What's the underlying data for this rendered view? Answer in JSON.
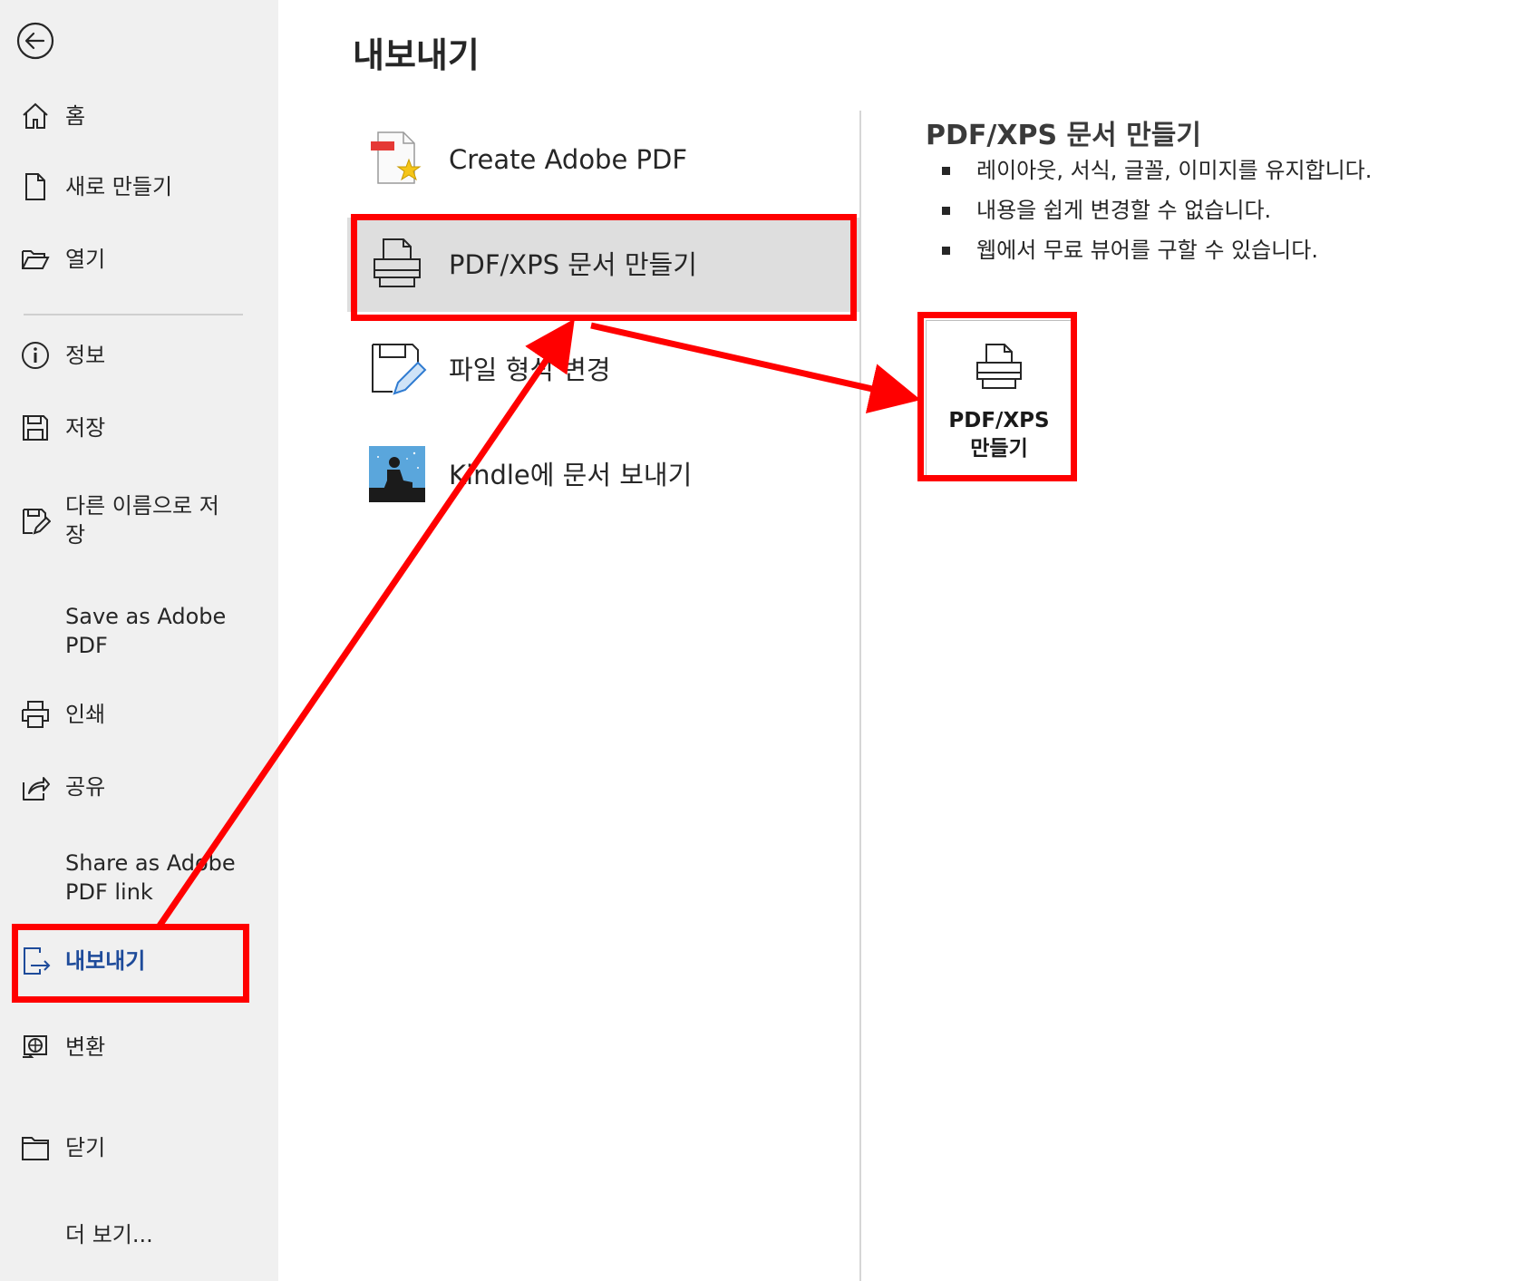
{
  "sidebar": {
    "items": [
      {
        "label": "홈",
        "icon": "home-icon"
      },
      {
        "label": "새로 만들기",
        "icon": "new-document-icon"
      },
      {
        "label": "열기",
        "icon": "open-folder-icon"
      },
      {
        "label": "정보",
        "icon": "info-icon"
      },
      {
        "label": "저장",
        "icon": "save-icon"
      },
      {
        "label": "다른 이름으로 저\n장",
        "icon": "save-as-icon"
      },
      {
        "label": "Save as Adobe\nPDF",
        "icon": ""
      },
      {
        "label": "인쇄",
        "icon": "printer-icon"
      },
      {
        "label": "공유",
        "icon": "share-icon"
      },
      {
        "label": "Share as Adobe\nPDF link",
        "icon": ""
      },
      {
        "label": "내보내기",
        "icon": "export-icon"
      },
      {
        "label": "변환",
        "icon": "transform-icon"
      },
      {
        "label": "닫기",
        "icon": "close-folder-icon"
      },
      {
        "label": "더 보기...",
        "icon": ""
      }
    ],
    "back_icon": "back-arrow-icon",
    "active_label": "내보내기"
  },
  "main": {
    "title": "내보내기",
    "export_options": [
      {
        "label": "Create Adobe PDF",
        "icon": "adobe-pdf-icon"
      },
      {
        "label": "PDF/XPS 문서 만들기",
        "icon": "pdf-xps-printer-icon"
      },
      {
        "label": "파일 형식 변경",
        "icon": "change-file-type-icon"
      },
      {
        "label": "Kindle에 문서 보내기",
        "icon": "kindle-icon"
      }
    ],
    "selected_option": "PDF/XPS 문서 만들기"
  },
  "detail": {
    "title": "PDF/XPS 문서 만들기",
    "bullets": [
      "레이아웃, 서식, 글꼴, 이미지를 유지합니다.",
      "내용을 쉽게 변경할 수 없습니다.",
      "웹에서 무료 뷰어를 구할 수 있습니다."
    ],
    "button_label": "PDF/XPS\n만들기",
    "button_icon": "pdf-xps-printer-icon"
  },
  "colors": {
    "sidebar_bg": "#f0f0f0",
    "active_text": "#1e4b9a",
    "selected_bg": "#dedede",
    "annotation": "#ff0000"
  }
}
